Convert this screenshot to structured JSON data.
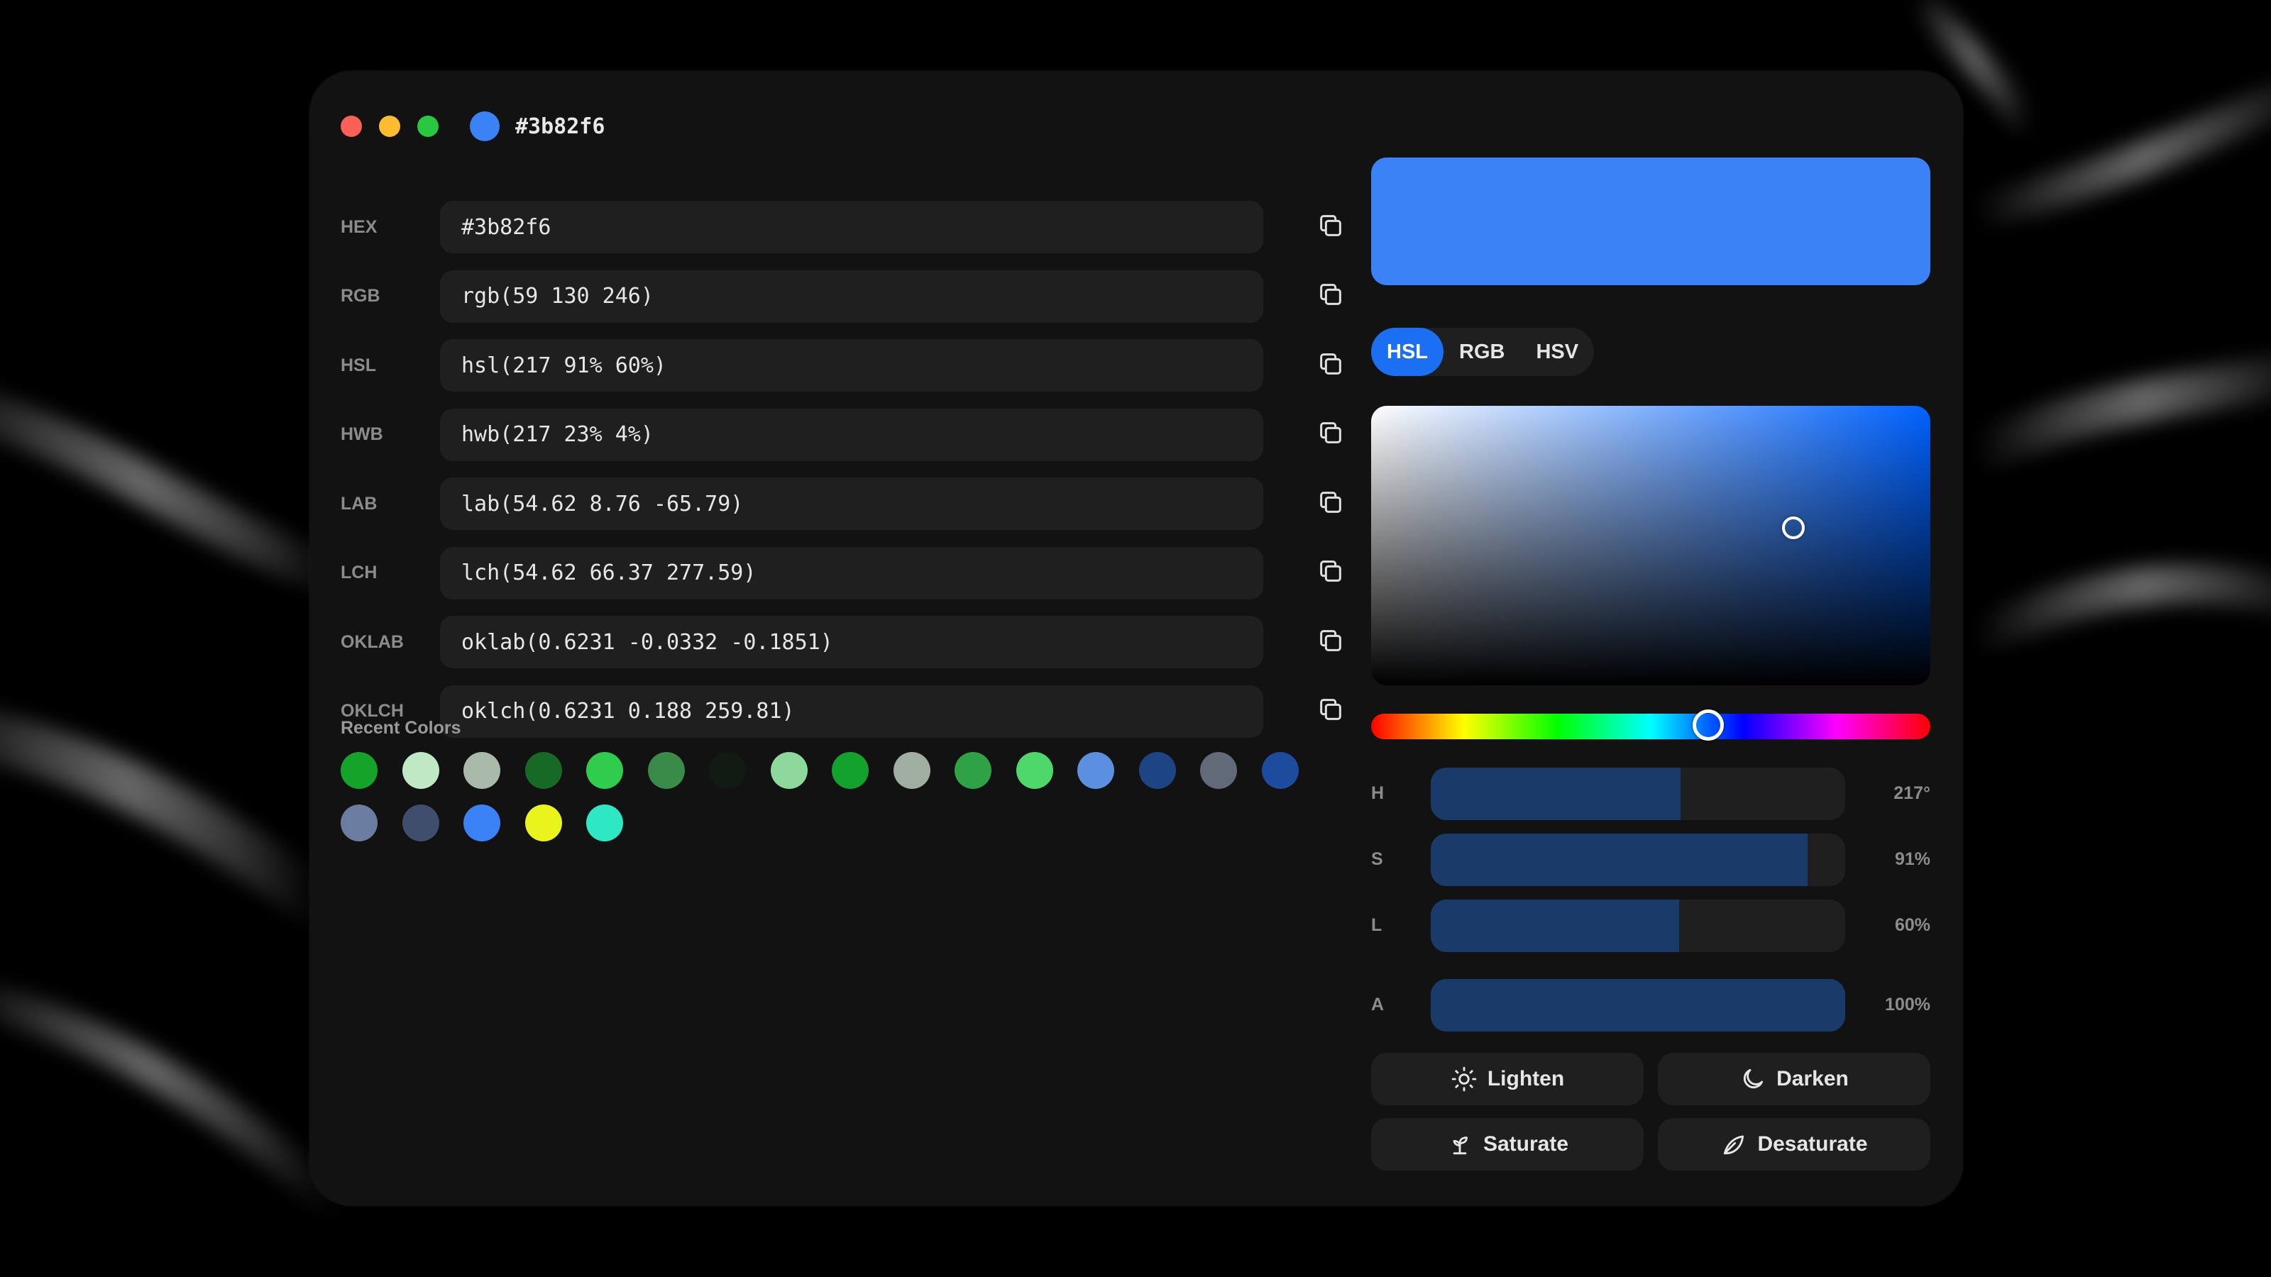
{
  "window": {
    "traffic_lights": [
      "#fe5f57",
      "#febc2e",
      "#28c840"
    ],
    "title": "#3b82f6",
    "title_swatch": "#3b82f6"
  },
  "formats": [
    {
      "label": "HEX",
      "value": "#3b82f6"
    },
    {
      "label": "RGB",
      "value": "rgb(59 130 246)"
    },
    {
      "label": "HSL",
      "value": "hsl(217 91% 60%)"
    },
    {
      "label": "HWB",
      "value": "hwb(217 23% 4%)"
    },
    {
      "label": "LAB",
      "value": "lab(54.62 8.76 -65.79)"
    },
    {
      "label": "LCH",
      "value": "lch(54.62 66.37 277.59)"
    },
    {
      "label": "OKLAB",
      "value": "oklab(0.6231 -0.0332 -0.1851)"
    },
    {
      "label": "OKLCH",
      "value": "oklch(0.6231 0.188 259.81)"
    }
  ],
  "copy_icon": "copy-icon",
  "recent": {
    "title": "Recent Colors",
    "colors": [
      "#16a32a",
      "#bfe8c4",
      "#a9b9aa",
      "#166a25",
      "#2fcc4d",
      "#3a8a4a",
      "#111a13",
      "#8dd89b",
      "#13a22e",
      "#a0aea2",
      "#2fa247",
      "#4ed76a",
      "#5b8fe0",
      "#1d4585",
      "#616a78",
      "#1d4c9e",
      "#6a7c9f",
      "#3f4e6c",
      "#3b82f6",
      "#e8f41c",
      "#2ee8c4"
    ]
  },
  "preview_color": "#3b82f6",
  "modes": [
    "HSL",
    "RGB",
    "HSV"
  ],
  "active_mode": "HSL",
  "picker": {
    "hue_deg": 217,
    "saturation": 0.91,
    "lightness": 0.6
  },
  "sliders": [
    {
      "label": "H",
      "value": "217°",
      "fraction": 0.603
    },
    {
      "label": "S",
      "value": "91%",
      "fraction": 0.91
    },
    {
      "label": "L",
      "value": "60%",
      "fraction": 0.6
    },
    {
      "label": "A",
      "value": "100%",
      "fraction": 1.0
    }
  ],
  "actions": [
    {
      "label": "Lighten",
      "icon": "sun-icon"
    },
    {
      "label": "Darken",
      "icon": "moon-icon"
    },
    {
      "label": "Saturate",
      "icon": "sprout-icon"
    },
    {
      "label": "Desaturate",
      "icon": "leaf-icon"
    }
  ]
}
